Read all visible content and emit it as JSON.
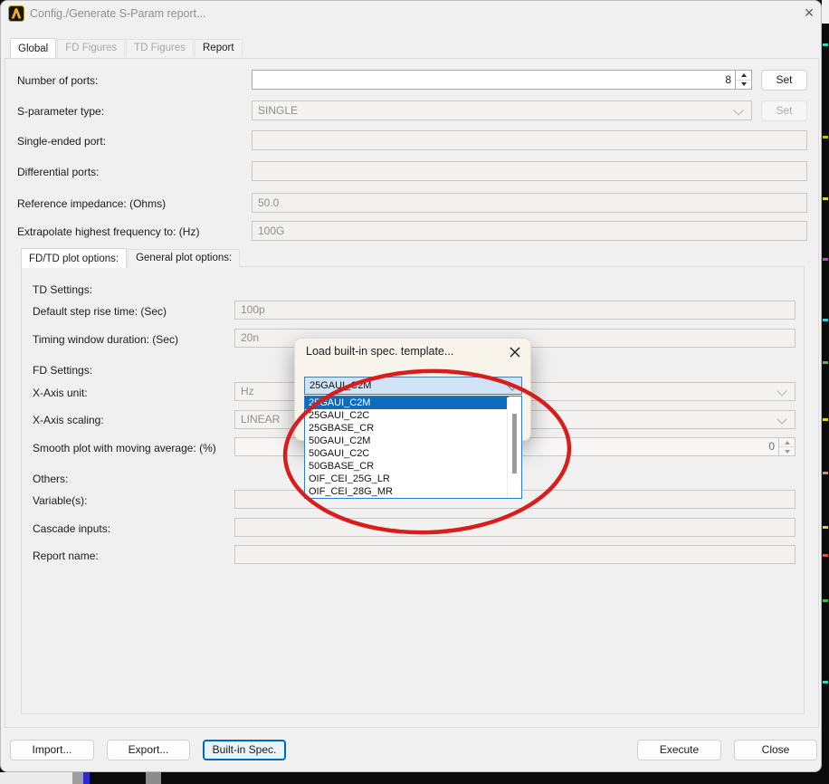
{
  "window": {
    "title": "Config./Generate S-Param report...",
    "close_glyph": "×"
  },
  "tabs": [
    {
      "label": "Global",
      "state": "active"
    },
    {
      "label": "FD Figures",
      "state": "disabled"
    },
    {
      "label": "TD Figures",
      "state": "disabled"
    },
    {
      "label": "Report",
      "state": "normal"
    }
  ],
  "fields": {
    "number_of_ports": {
      "label": "Number of ports:",
      "value": "8",
      "set_label": "Set"
    },
    "s_parameter_type": {
      "label": "S-parameter type:",
      "value": "SINGLE",
      "set_label": "Set"
    },
    "single_ended_port": {
      "label": "Single-ended port:",
      "value": ""
    },
    "differential_ports": {
      "label": "Differential ports:",
      "value": ""
    },
    "reference_impedance": {
      "label": "Reference impedance: (Ohms)",
      "value": "50.0"
    },
    "extrapolate_frequency": {
      "label": "Extrapolate highest frequency to: (Hz)",
      "value": "100G"
    }
  },
  "plot_tabs": [
    {
      "label": "FD/TD plot options:",
      "state": "active"
    },
    {
      "label": "General plot options:",
      "state": "normal"
    }
  ],
  "plot_options": {
    "td_settings_heading": "TD Settings:",
    "default_step_rise_time": {
      "label": "Default step rise time: (Sec)",
      "value": "100p"
    },
    "timing_window_duration": {
      "label": "Timing window duration: (Sec)",
      "value": "20n"
    },
    "fd_settings_heading": "FD Settings:",
    "x_axis_unit": {
      "label": "X-Axis unit:",
      "value": "Hz"
    },
    "x_axis_scaling": {
      "label": "X-Axis scaling:",
      "value": "LINEAR"
    },
    "smooth_plot": {
      "label": "Smooth plot with moving average: (%)",
      "value": "0"
    },
    "others_heading": "Others:",
    "variables": {
      "label": "Variable(s):",
      "value": ""
    },
    "cascade_inputs": {
      "label": "Cascade inputs:",
      "value": ""
    },
    "report_name": {
      "label": "Report name:",
      "value": ""
    }
  },
  "footer": {
    "import_label": "Import...",
    "export_label": "Export...",
    "builtin_label": "Built-in Spec.",
    "execute_label": "Execute",
    "close_label": "Close"
  },
  "popup": {
    "title": "Load built-in spec. template...",
    "combo_value": "25GAUI_C2M",
    "selected_item": "25GAUI_C2M",
    "items": [
      "25GAUI_C2M",
      "25GAUI_C2C",
      "25GBASE_CR",
      "50GAUI_C2M",
      "50GAUI_C2C",
      "50GBASE_CR",
      "OIF_CEI_25G_LR",
      "OIF_CEI_28G_MR"
    ]
  },
  "colors": {
    "selection_blue": "#0f6cbd",
    "combo_focus_bg": "#cfe5f7",
    "accent_blue": "#0067c0",
    "annotation_red": "#d81d1d",
    "popup_bg": "#f8f4ec",
    "dialog_bg": "#f0f0f0"
  }
}
